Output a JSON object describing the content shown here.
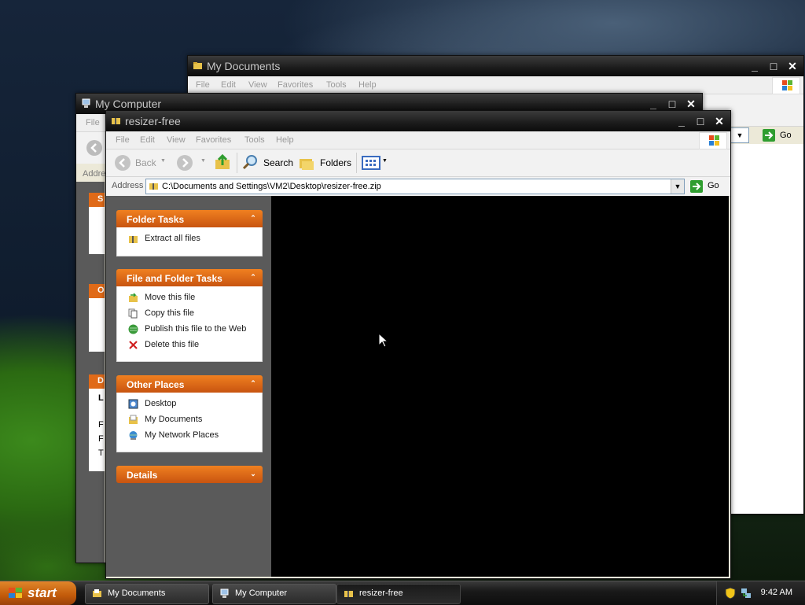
{
  "windows": {
    "my_documents": {
      "title": "My Documents",
      "menu": [
        "File",
        "Edit",
        "View",
        "Favorites",
        "Tools",
        "Help"
      ],
      "go_label": "Go"
    },
    "my_computer": {
      "title": "My Computer",
      "menu_file": "File",
      "address_label": "Addre",
      "side_letters": [
        "S",
        "O",
        "D",
        "L",
        "F",
        "F",
        "T"
      ]
    },
    "resizer": {
      "title": "resizer-free",
      "menu": [
        "File",
        "Edit",
        "View",
        "Favorites",
        "Tools",
        "Help"
      ],
      "toolbar": {
        "back": "Back",
        "search": "Search",
        "folders": "Folders"
      },
      "address": {
        "label": "Address",
        "value": "C:\\Documents and Settings\\VM2\\Desktop\\resizer-free.zip",
        "go": "Go"
      },
      "tasks": [
        {
          "title": "Folder Tasks",
          "items": [
            {
              "label": "Extract all files",
              "icon": "extract-icon"
            }
          ]
        },
        {
          "title": "File and Folder Tasks",
          "items": [
            {
              "label": "Move this file",
              "icon": "move-icon"
            },
            {
              "label": "Copy this file",
              "icon": "copy-icon"
            },
            {
              "label": "Publish this file to the Web",
              "icon": "globe-icon"
            },
            {
              "label": "Delete this file",
              "icon": "delete-icon"
            }
          ]
        },
        {
          "title": "Other Places",
          "items": [
            {
              "label": "Desktop",
              "icon": "desktop-icon"
            },
            {
              "label": "My Documents",
              "icon": "folder-icon"
            },
            {
              "label": "My Network Places",
              "icon": "network-icon"
            }
          ]
        },
        {
          "title": "Details",
          "items": []
        }
      ]
    }
  },
  "taskbar": {
    "start": "start",
    "tasks": [
      "My Documents",
      "My Computer",
      "resizer-free"
    ],
    "clock": "9:42 AM"
  },
  "colors": {
    "task_header": "#e06a18",
    "panel_bg": "#5a5a5a",
    "content_bg": "#000000",
    "titlebar": "#1b1b1b"
  }
}
